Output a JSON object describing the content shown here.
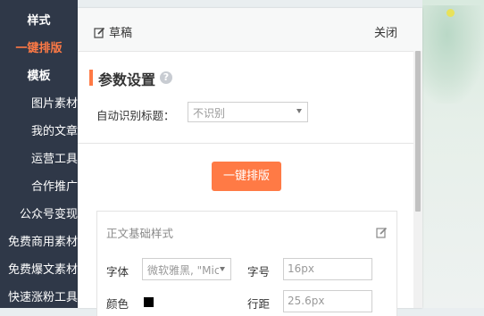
{
  "sidebar": {
    "items": [
      {
        "label": "样式"
      },
      {
        "label": "一键排版"
      },
      {
        "label": "模板"
      },
      {
        "label": "图片素材"
      },
      {
        "label": "我的文章"
      },
      {
        "label": "运营工具"
      },
      {
        "label": "合作推广"
      },
      {
        "label": "公众号变现"
      },
      {
        "label": "免费商用素材"
      },
      {
        "label": "免费爆文素材"
      },
      {
        "label": "快速涨粉工具"
      }
    ],
    "active_label": "一键排版",
    "bg_color": "#2f3848",
    "active_color": "#ff7a45"
  },
  "panel": {
    "header": {
      "draft_label": "草稿",
      "close_label": "关闭"
    },
    "section_title": "参数设置",
    "auto_title": {
      "label": "自动识别标题：",
      "value": "不识别"
    },
    "format_button": "一键排版",
    "card": {
      "title": "正文基础样式",
      "font_label": "字体",
      "font_value": "微软雅黑, \"Mic",
      "size_label": "字号",
      "size_value": "16px",
      "color_label": "颜色",
      "color_value": "#000000",
      "line_height_label": "行距",
      "line_height_value": "25.6px"
    }
  },
  "icons": {
    "draft": "edit-icon",
    "help": "question-icon",
    "card_edit": "edit-icon"
  },
  "colors": {
    "accent": "#ff7a45"
  }
}
